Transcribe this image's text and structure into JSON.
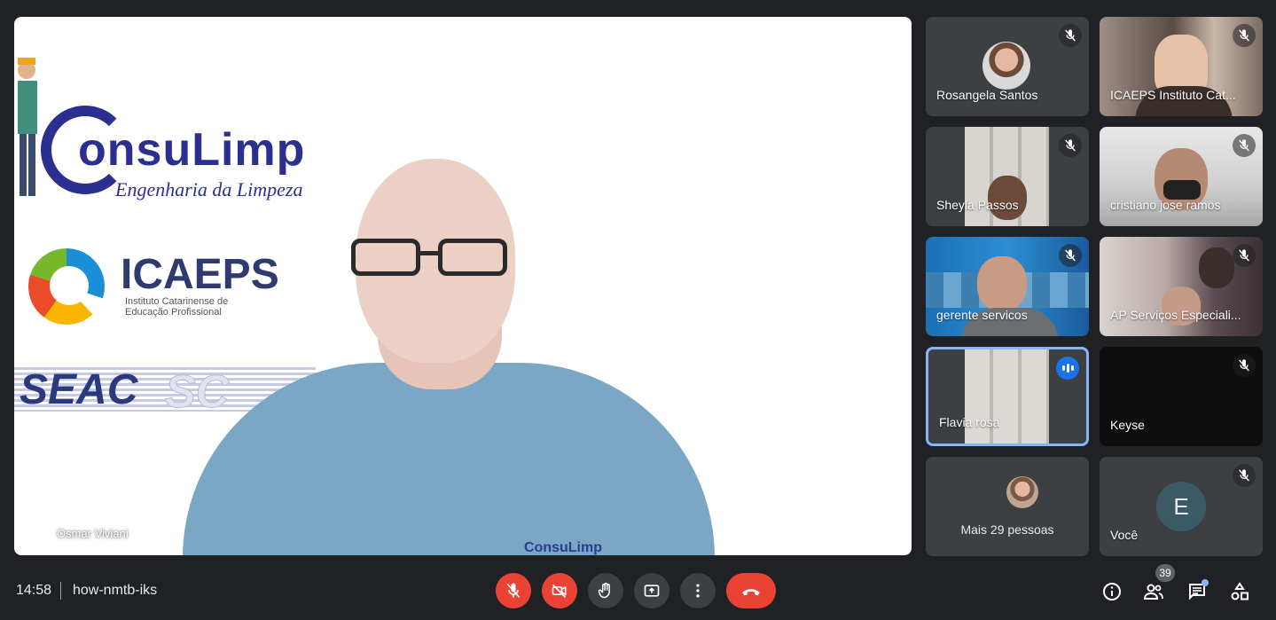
{
  "stage": {
    "speaker_name": "Osmar Viviani",
    "logos": {
      "consulimp_brand": "onsuLimp",
      "consulimp_tagline": "Engenharia da Limpeza",
      "icaeps_name": "ICAEPS",
      "icaeps_subtitle": "Instituto Catarinense de Educação Profissional",
      "seac": "SEAC",
      "sc": "SC",
      "shirt_logo": "ConsuLimp"
    }
  },
  "tiles": [
    {
      "name": "Rosangela Santos",
      "muted": true
    },
    {
      "name": "ICAEPS Instituto Cat...",
      "muted": true
    },
    {
      "name": "Sheyla Passos",
      "muted": true
    },
    {
      "name": "cristiano jose ramos",
      "muted": true
    },
    {
      "name": "gerente servicos",
      "muted": true
    },
    {
      "name": "AP Serviços Especiali...",
      "muted": true
    },
    {
      "name": "Flavia rosa",
      "muted": false,
      "speaking": true
    },
    {
      "name": "Keyse",
      "muted": true
    },
    {
      "name": "Mais 29 pessoas"
    },
    {
      "name": "Você",
      "avatar_letter": "E",
      "muted": true
    }
  ],
  "bottombar": {
    "time": "14:58",
    "meeting_code": "how-nmtb-iks",
    "participants_count": "39"
  },
  "colors": {
    "background": "#202124",
    "tile": "#3c4043",
    "danger": "#ea4335",
    "active_border": "#8ab4f8",
    "speaking": "#1a73e8"
  }
}
